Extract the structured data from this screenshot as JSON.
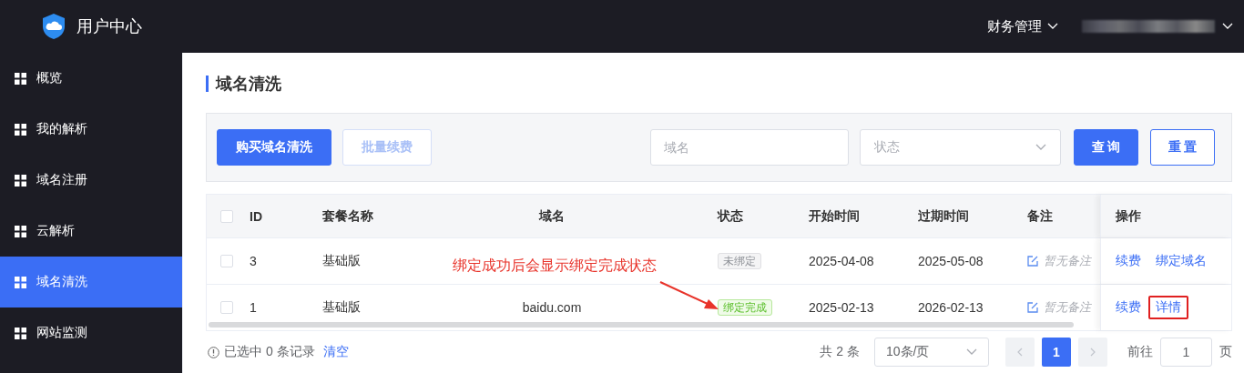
{
  "header": {
    "title": "用户中心",
    "menus": [
      {
        "label": "财务管理"
      }
    ]
  },
  "sidebar": {
    "items": [
      {
        "label": "概览",
        "selected": false
      },
      {
        "label": "我的解析",
        "selected": false
      },
      {
        "label": "域名注册",
        "selected": false
      },
      {
        "label": "云解析",
        "selected": false
      },
      {
        "label": "域名清洗",
        "selected": true
      },
      {
        "label": "网站监测",
        "selected": false
      }
    ]
  },
  "page": {
    "title": "域名清洗"
  },
  "toolbar": {
    "buttons": [
      {
        "label": "购买域名清洗",
        "kind": "primary"
      },
      {
        "label": "批量续费",
        "kind": "disabled"
      }
    ],
    "domain_field": {
      "placeholder": "域名"
    },
    "status_select": {
      "placeholder": "状态"
    },
    "actions": [
      {
        "label": "查 询",
        "kind": "primary"
      },
      {
        "label": "重 置",
        "kind": "outline"
      }
    ]
  },
  "table": {
    "all_checked": false,
    "columns": [
      "ID",
      "套餐名称",
      "域名",
      "状态",
      "开始时间",
      "过期时间",
      "备注",
      "操作"
    ],
    "rows": [
      {
        "checked": false,
        "id": "3",
        "package": "基础版",
        "status": {
          "label": "未绑定",
          "kind": "neutral"
        },
        "start": "2025-04-08",
        "end": "2025-05-08",
        "note": "暂无备注",
        "actions": [
          {
            "label": "续费",
            "highlighted": false
          },
          {
            "label": "绑定域名",
            "highlighted": false
          }
        ]
      },
      {
        "checked": false,
        "id": "1",
        "package": "基础版",
        "domain": "baidu.com",
        "status": {
          "label": "绑定完成",
          "kind": "success"
        },
        "start": "2025-02-13",
        "end": "2026-02-13",
        "note": "暂无备注",
        "actions": [
          {
            "label": "续费",
            "highlighted": false
          },
          {
            "label": "详情",
            "highlighted": true
          }
        ]
      }
    ]
  },
  "annotation": {
    "text": "绑定成功后会显示绑定完成状态"
  },
  "footer": {
    "selection_text": "已选中 0 条记录",
    "clear_link": "清空",
    "total": "共 2 条",
    "page_size": "10条/页",
    "pages": [
      {
        "label": "1",
        "selected": true
      }
    ],
    "goto_label": "前往",
    "goto_value": "1",
    "page_suffix": "页"
  }
}
